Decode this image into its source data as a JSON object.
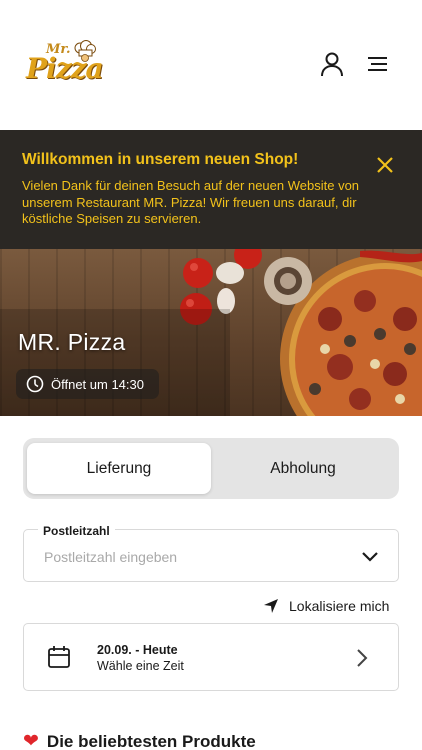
{
  "header": {
    "logo": {
      "mr": "Mr.",
      "pizza": "Pizza"
    },
    "icons": [
      "user-icon",
      "menu-icon"
    ]
  },
  "banner": {
    "title": "Willkommen in unserem neuen Shop!",
    "text": "Vielen Dank für deinen Besuch auf der neuen Website von unserem Restaurant MR. Pizza! Wir freuen uns darauf, dir köstliche Speisen zu servieren.",
    "close_icon": "close-icon",
    "colors": {
      "background": "#2b2824",
      "text": "#f2c21b"
    }
  },
  "hero": {
    "title": "MR. Pizza",
    "status": "Öffnet um 14:30",
    "status_icon": "clock-icon"
  },
  "order_mode": {
    "options": [
      "Lieferung",
      "Abholung"
    ],
    "selected": "Lieferung"
  },
  "postcode": {
    "label": "Postleitzahl",
    "placeholder": "Postleitzahl eingeben",
    "value": ""
  },
  "locate": {
    "label": "Lokalisiere mich",
    "icon": "location-arrow-icon"
  },
  "time": {
    "date": "20.09. - Heute",
    "prompt": "Wähle eine Zeit",
    "icon": "calendar-icon"
  },
  "popular": {
    "heading": "Die beliebtesten Produkte",
    "icon": "heart-icon",
    "heart_color": "#e0262b"
  }
}
